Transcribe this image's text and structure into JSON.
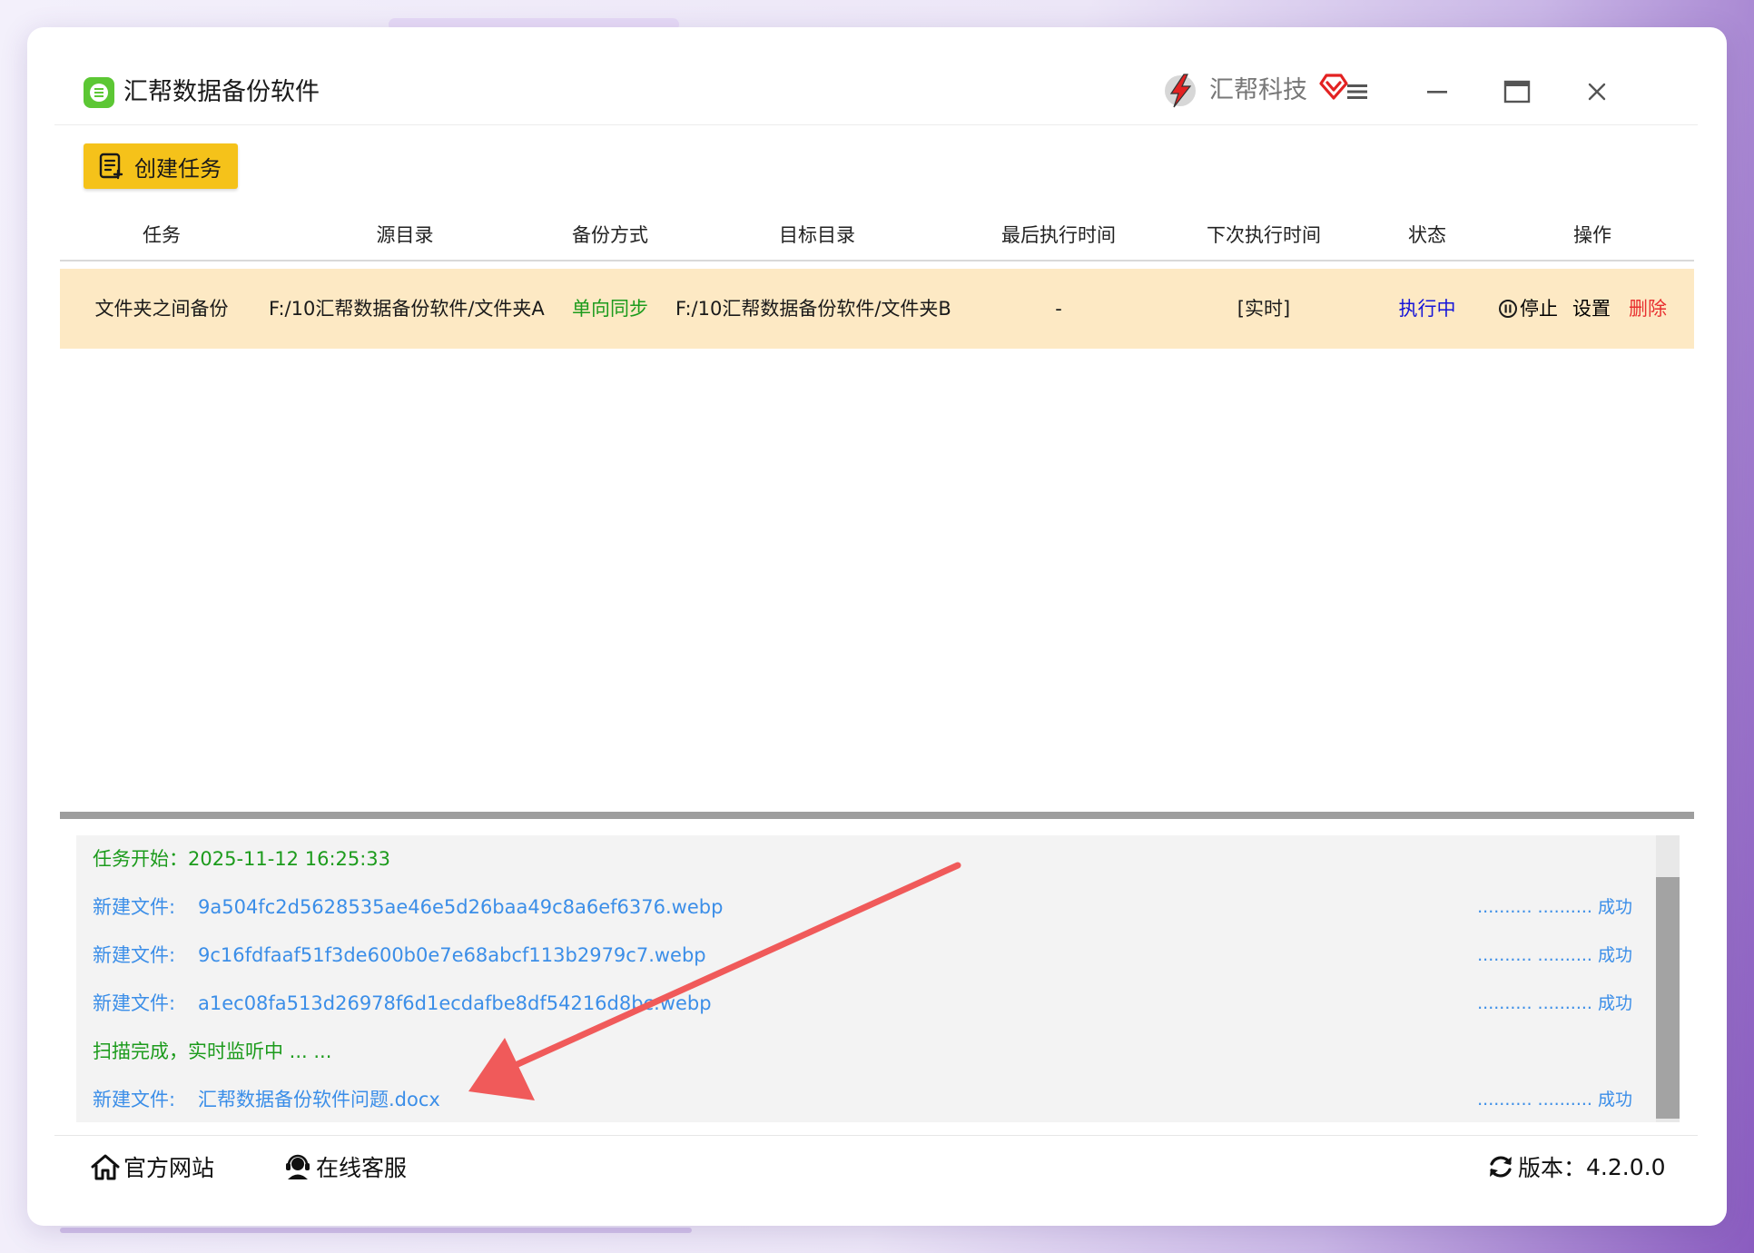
{
  "app": {
    "title": "汇帮数据备份软件",
    "brand_name": "汇帮科技",
    "accent_color": "#5cc734",
    "icons": [
      "app-logo-icon",
      "brand-logo-icon",
      "vip-heart-icon",
      "menu-icon",
      "minimize-icon",
      "maximize-icon",
      "close-icon"
    ]
  },
  "toolbar": {
    "create_label": "创建任务",
    "create_color": "#f5c21a"
  },
  "table": {
    "columns": [
      "任务",
      "源目录",
      "备份方式",
      "目标目录",
      "最后执行时间",
      "下次执行时间",
      "状态",
      "操作"
    ],
    "rows": [
      {
        "task": "文件夹之间备份",
        "source": "F:/10汇帮数据备份软件/文件夹A",
        "mode": "单向同步",
        "target": "F:/10汇帮数据备份软件/文件夹B",
        "last_run": "-",
        "next_run": "[实时]",
        "status": "执行中",
        "actions": {
          "stop": "停止",
          "settings": "设置",
          "delete": "删除"
        }
      }
    ]
  },
  "log": {
    "lines": [
      {
        "type": "start",
        "text": "任务开始：2025-11-12 16:25:33"
      },
      {
        "type": "file",
        "tag": "新建文件:",
        "name": "9a504fc2d5628535ae46e5d26baa49c8a6ef6376.webp",
        "status": ".......... .......... 成功"
      },
      {
        "type": "file",
        "tag": "新建文件:",
        "name": "9c16fdfaaf51f3de600b0e7e68abcf113b2979c7.webp",
        "status": ".......... .......... 成功"
      },
      {
        "type": "file",
        "tag": "新建文件:",
        "name": "a1ec08fa513d26978f6d1ecdafbe8df54216d8bc.webp",
        "status": ".......... .......... 成功"
      },
      {
        "type": "scan",
        "text": "扫描完成，实时监听中 ... ..."
      },
      {
        "type": "file",
        "tag": "新建文件:",
        "name": "汇帮数据备份软件问题.docx",
        "status": ".......... .......... 成功"
      }
    ]
  },
  "footer": {
    "website": "官方网站",
    "support": "在线客服",
    "version_label": "版本：",
    "version": "4.2.0.0"
  },
  "annotation": {
    "arrow_color": "#f05a5a"
  }
}
